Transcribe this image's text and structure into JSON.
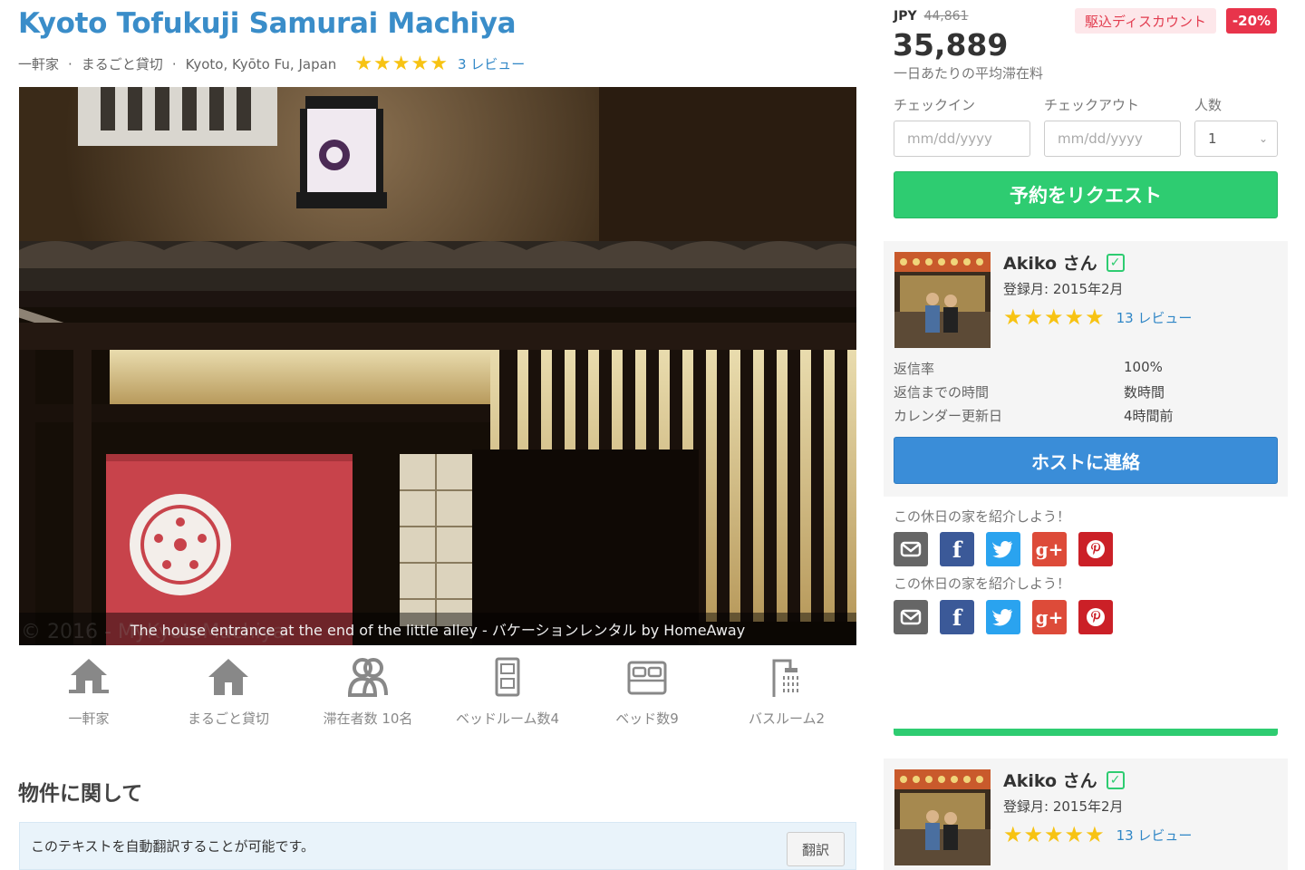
{
  "listing": {
    "title": "Kyoto Tofukuji Samurai Machiya",
    "type": "一軒家",
    "rental": "まるごと貸切",
    "location": "Kyoto, Kyōto Fu, Japan",
    "rating_stars": "★★★★★",
    "review_count": "3 レビュー",
    "photo_caption": "The house entrance at the end of the little alley - バケーションレンタル by HomeAway",
    "photo_watermark": "© 2016 - MyKyotoMachiya"
  },
  "amenities": [
    {
      "icon": "house-icon",
      "label": "一軒家"
    },
    {
      "icon": "home-icon",
      "label": "まるごと貸切"
    },
    {
      "icon": "guests-icon",
      "label": "滞在者数 10名"
    },
    {
      "icon": "door-icon",
      "label": "ベッドルーム数4"
    },
    {
      "icon": "bed-icon",
      "label": "ベッド数9"
    },
    {
      "icon": "shower-icon",
      "label": "バスルーム2"
    }
  ],
  "about": {
    "heading": "物件に関して",
    "translate_notice": "このテキストを自動翻訳することが可能です。",
    "translate_button": "翻訳"
  },
  "pricing": {
    "currency": "JPY",
    "original_price": "44,861",
    "discount_label": "駆込ディスカウント",
    "discount_pct": "-20%",
    "price": "35,889",
    "price_note": "一日あたりの平均滞在料"
  },
  "booking": {
    "checkin_label": "チェックイン",
    "checkout_label": "チェックアウト",
    "guests_label": "人数",
    "checkin_placeholder": "mm/dd/yyyy",
    "checkout_placeholder": "mm/dd/yyyy",
    "guests_value": "1",
    "request_button": "予約をリクエスト"
  },
  "host": {
    "name": "Akiko さん",
    "since": "登録月: 2015年2月",
    "rating_stars": "★★★★★",
    "review_count": "13 レビュー",
    "stats": [
      {
        "label": "返信率",
        "value": "100%"
      },
      {
        "label": "返信までの時間",
        "value": "数時間"
      },
      {
        "label": "カレンダー更新日",
        "value": "4時間前"
      }
    ],
    "contact_button": "ホストに連絡"
  },
  "share": {
    "label": "この休日の家を紹介しよう！",
    "fb_glyph": "f",
    "gp_glyph": "g+"
  },
  "colors": {
    "title_blue": "#3a8dc9",
    "book_green": "#2ecc71",
    "contact_blue": "#3a8dd8",
    "discount_red": "#e8344b",
    "star_yellow": "#f7c313"
  }
}
